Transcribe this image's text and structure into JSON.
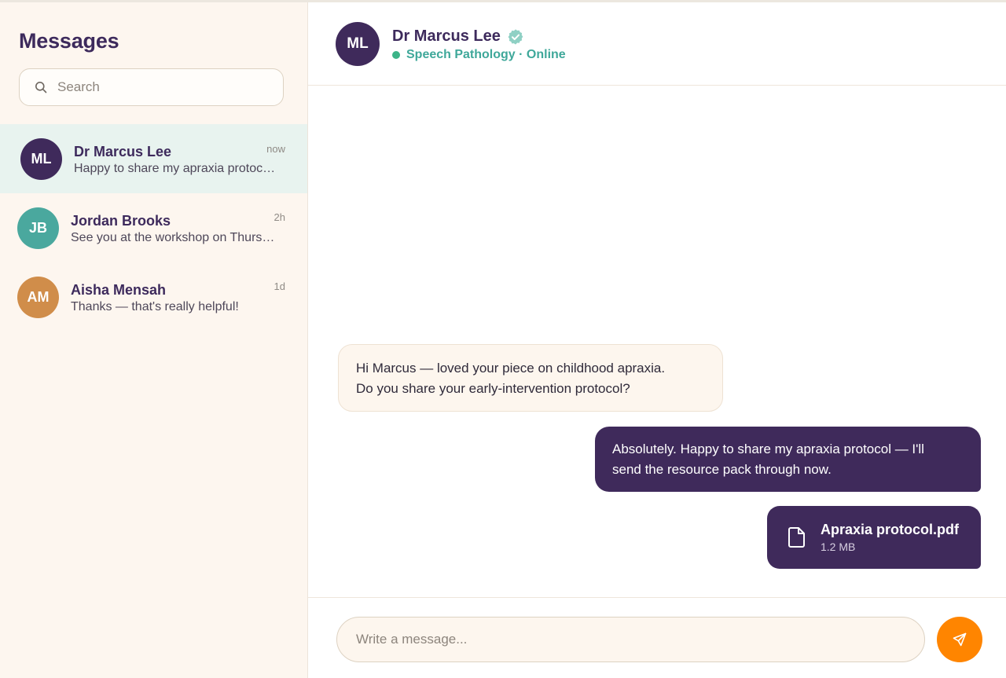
{
  "sidebar": {
    "title": "Messages",
    "search": {
      "placeholder": "Search",
      "value": "",
      "icon": "search-icon"
    },
    "conversations": [
      {
        "initials": "ML",
        "name": "Dr Marcus Lee",
        "preview": "Happy to share my apraxia protocol — I'll send the resource pack through now.",
        "time": "now",
        "active": true,
        "avatar_color": "#3f2a5b"
      },
      {
        "initials": "JB",
        "name": "Jordan Brooks",
        "preview": "See you at the workshop on Thursday!",
        "time": "2h",
        "active": false,
        "avatar_color": "#4aa89e"
      },
      {
        "initials": "AM",
        "name": "Aisha Mensah",
        "preview": "Thanks — that's really helpful!",
        "time": "1d",
        "active": false,
        "avatar_color": "#d08d4a"
      }
    ]
  },
  "chat": {
    "contact": {
      "initials": "ML",
      "name": "Dr Marcus Lee",
      "verified_icon": "verified-badge-icon",
      "status": "Speech Pathology · Online"
    },
    "messages": [
      {
        "direction": "incoming",
        "lines": [
          "Hi Marcus — loved your piece on childhood apraxia.",
          "Do you share your early-intervention protocol?"
        ]
      },
      {
        "direction": "outgoing",
        "lines": [
          "Absolutely. Happy to share my apraxia protocol — I'll",
          "send the resource pack through now."
        ]
      }
    ],
    "attachment": {
      "name": "Apraxia protocol.pdf",
      "size": "1.2 MB",
      "icon": "file-icon"
    },
    "composer": {
      "placeholder": "Write a message...",
      "value": "",
      "send_icon": "send-icon"
    }
  },
  "colors": {
    "primary": "#3f2a5b",
    "accent": "#ff8500",
    "online": "#3cb488",
    "sidebar_bg": "#fdf6ef",
    "active_item_bg": "#e8f3ef"
  }
}
